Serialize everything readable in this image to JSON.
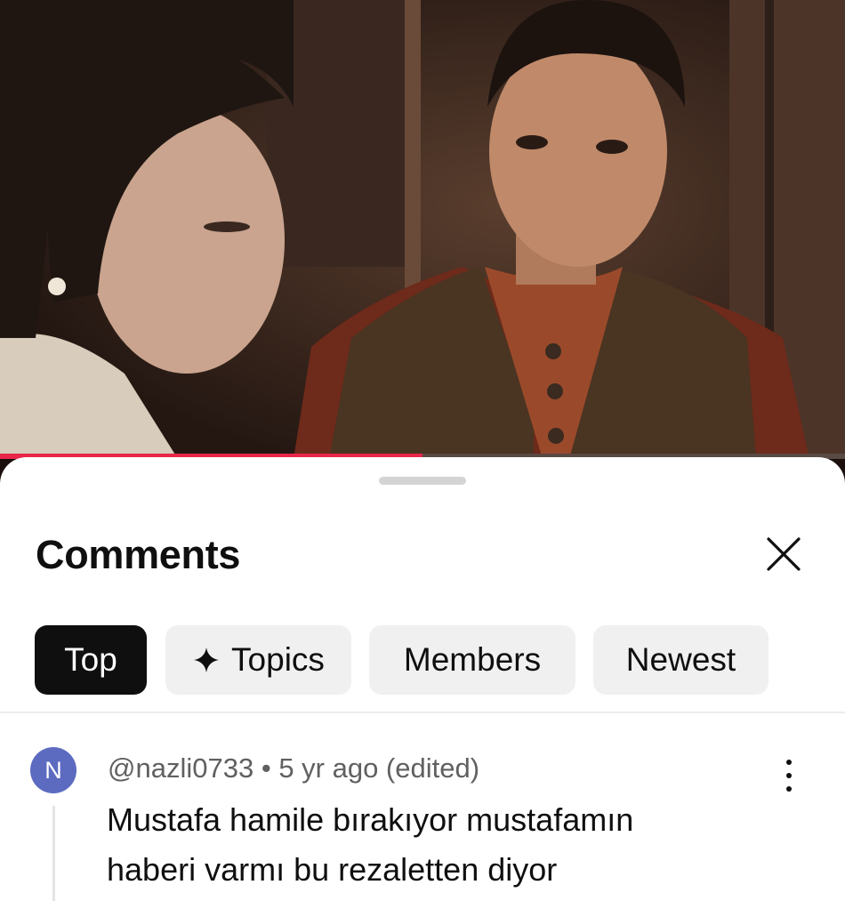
{
  "video": {
    "progress_fraction": 0.5,
    "progress_color": "#e8264a"
  },
  "comments_panel": {
    "title": "Comments",
    "close_icon": "close-icon",
    "filters": [
      {
        "label": "Top",
        "active": true
      },
      {
        "label": "Topics",
        "active": false,
        "icon": "sparkle-icon"
      },
      {
        "label": "Members",
        "active": false
      },
      {
        "label": "Newest",
        "active": false
      }
    ]
  },
  "comment": {
    "avatar_letter": "N",
    "avatar_color": "#5c6bc0",
    "author": "@nazli0733",
    "separator": "•",
    "time": "5 yr ago (edited)",
    "text": "Mustafa hamile bırakıyor mustafamın haberi varmı bu rezaletten diyor",
    "menu_icon": "more-vertical-icon"
  }
}
